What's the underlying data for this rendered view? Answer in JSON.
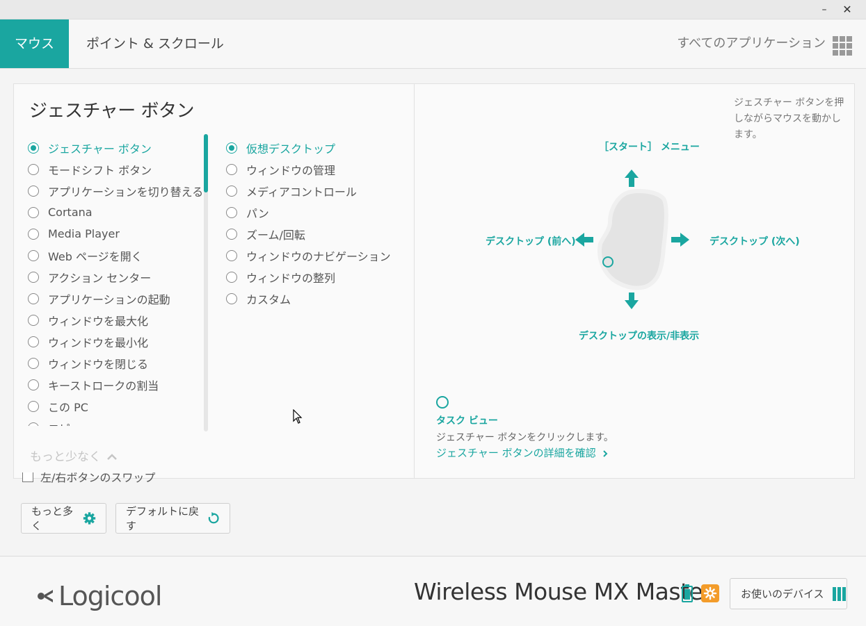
{
  "window": {
    "minimize": "–",
    "close": "✕"
  },
  "tabs": [
    {
      "label": "マウス",
      "active": true
    },
    {
      "label": "ポイント & スクロール",
      "active": false
    }
  ],
  "header": {
    "all_apps": "すべてのアプリケーション",
    "grid_icon": "grid-icon"
  },
  "panel": {
    "title": "ジェスチャー ボタン",
    "list1": [
      {
        "label": "ジェスチャー ボタン",
        "selected": true
      },
      {
        "label": "モードシフト ボタン",
        "selected": false
      },
      {
        "label": "アプリケーションを切り替える",
        "selected": false
      },
      {
        "label": "Cortana",
        "selected": false
      },
      {
        "label": "Media Player",
        "selected": false
      },
      {
        "label": "Web ページを開く",
        "selected": false
      },
      {
        "label": "アクション センター",
        "selected": false
      },
      {
        "label": "アプリケーションの起動",
        "selected": false
      },
      {
        "label": "ウィンドウを最大化",
        "selected": false
      },
      {
        "label": "ウィンドウを最小化",
        "selected": false
      },
      {
        "label": "ウィンドウを閉じる",
        "selected": false
      },
      {
        "label": "キーストロークの割当",
        "selected": false
      },
      {
        "label": "この PC",
        "selected": false
      },
      {
        "label": "コピー",
        "selected": false
      }
    ],
    "list2": [
      {
        "label": "仮想デスクトップ",
        "selected": true
      },
      {
        "label": "ウィンドウの管理",
        "selected": false
      },
      {
        "label": "メディアコントロール",
        "selected": false
      },
      {
        "label": "パン",
        "selected": false
      },
      {
        "label": "ズーム/回転",
        "selected": false
      },
      {
        "label": "ウィンドウのナビゲーション",
        "selected": false
      },
      {
        "label": "ウィンドウの整列",
        "selected": false
      },
      {
        "label": "カスタム",
        "selected": false
      }
    ],
    "less_link": "もっと少なく"
  },
  "diagram": {
    "hint": "ジェスチャー ボタンを押しながらマウスを動かします。",
    "up": "［スタート］ メニュー",
    "left": "デスクトップ (前へ)",
    "right": "デスクトップ (次へ)",
    "down": "デスクトップの表示/非表示",
    "task_view_title": "タスク ビュー",
    "task_view_desc": "ジェスチャー ボタンをクリックします。",
    "task_view_link": "ジェスチャー ボタンの詳細を確認"
  },
  "options": {
    "swap_label": "左/右ボタンのスワップ"
  },
  "buttons": {
    "more": "もっと多く",
    "default": "デフォルトに戻す"
  },
  "footer": {
    "logo": "Logicool",
    "device_name": "Wireless Mouse MX Master",
    "devices_button": "お使いのデバイス"
  },
  "colors": {
    "accent": "#1aa6a0",
    "flow": "#f39c2a"
  }
}
